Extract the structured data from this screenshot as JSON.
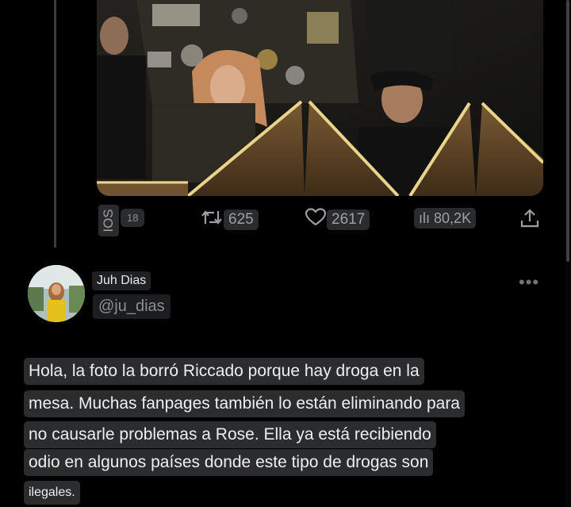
{
  "colors": {
    "background": "#000000",
    "pill": "#2b2c2e",
    "text": "#e7e9ea",
    "muted": "#8b8f94"
  },
  "media": {
    "icon": "photo-image"
  },
  "actions": {
    "side_label": "IOS",
    "small_count": "18",
    "retweets": "625",
    "likes": "2617",
    "views": "80,2K",
    "views_prefix": "ılı"
  },
  "reply": {
    "name": "Juh Dias",
    "handle": "@ju_dias",
    "lines": [
      "Hola, la foto la borró Riccado porque hay droga en la",
      "mesa. Muchas fanpages también lo están eliminando para",
      "no causarle problemas a Rose. Ella ya está recibiendo",
      "odio en algunos países donde este tipo de drogas son",
      "ilegales."
    ]
  }
}
